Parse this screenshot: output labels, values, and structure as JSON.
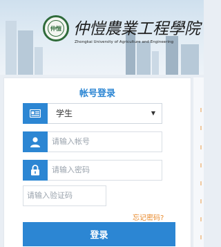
{
  "header": {
    "school_name_cn": "仲愷農業工程學院",
    "school_name_en": "Zhongkai University of Agriculture and Engineering",
    "logo_text": "仲愷"
  },
  "login": {
    "title": "帐号登录",
    "role_select": {
      "selected": "学生"
    },
    "account_input": {
      "placeholder": "请输入帐号",
      "value": ""
    },
    "password_input": {
      "placeholder": "请输入密码",
      "value": ""
    },
    "captcha_input": {
      "placeholder": "请输入验证码",
      "value": ""
    },
    "forgot_password": "忘记密码?",
    "submit_label": "登录"
  },
  "colors": {
    "accent": "#2c86d3",
    "forgot_link": "#e8892a"
  },
  "icons": {
    "role": "id-card-icon",
    "account": "user-icon",
    "password": "lock-icon",
    "select_caret": "caret-down-icon"
  }
}
